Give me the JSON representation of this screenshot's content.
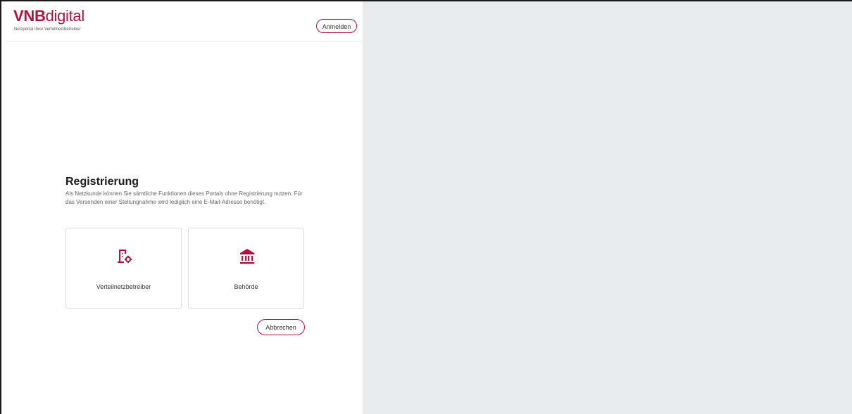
{
  "header": {
    "logo_bold": "VNB",
    "logo_light": "digital",
    "tagline": "Netzportal Ihrer Verteilnetzbetreiber",
    "login_label": "Anmelden"
  },
  "main": {
    "title": "Registrierung",
    "description": "Als Netzkunde können Sie sämtliche Funktionen dieses Portals ohne Registrierung nutzen. Für das Versenden einer Stellungnahme wird lediglich eine E-Mail-Adresse benötigt.",
    "cards": [
      {
        "label": "Verteilnetzbetreiber",
        "icon": "building-gear-icon"
      },
      {
        "label": "Behörde",
        "icon": "government-building-icon"
      }
    ],
    "cancel_label": "Abbrechen"
  },
  "colors": {
    "accent": "#b5133f",
    "right_panel_bg": "#e9ecef"
  }
}
